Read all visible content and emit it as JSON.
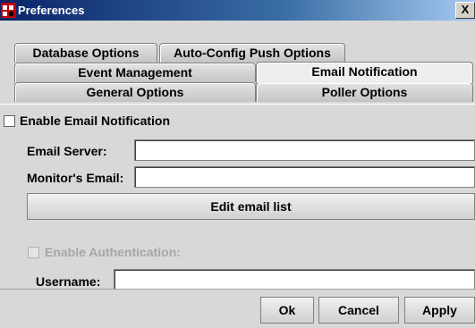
{
  "window": {
    "title": "Preferences",
    "close_glyph": "X"
  },
  "tabs": {
    "row1": [
      "Database Options",
      "Auto-Config Push Options"
    ],
    "row2": [
      "Event Management",
      "Email Notification"
    ],
    "row3": [
      "General Options",
      "Poller Options"
    ],
    "selected": "Email Notification"
  },
  "email": {
    "enable_label": "Enable Email Notification",
    "enable_checked": false,
    "server_label": "Email Server:",
    "server_value": "",
    "monitor_label": "Monitor's Email:",
    "monitor_value": "",
    "edit_list_label": "Edit email list"
  },
  "auth": {
    "enable_label": "Enable Authentication:",
    "enable_checked": false,
    "username_label": "Username:",
    "username_value": ""
  },
  "buttons": {
    "ok": "Ok",
    "cancel": "Cancel",
    "apply": "Apply"
  }
}
